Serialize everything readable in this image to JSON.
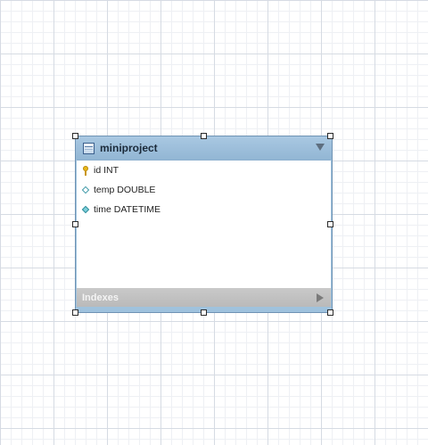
{
  "diagram": {
    "table": {
      "name": "miniproject",
      "columns": [
        {
          "icon": "primary-key-icon",
          "text": "id INT"
        },
        {
          "icon": "column-diamond-icon",
          "text": "temp DOUBLE"
        },
        {
          "icon": "column-diamond-filled-icon",
          "text": "time DATETIME"
        }
      ],
      "indexes_label": "Indexes"
    },
    "colors": {
      "header": "#9fc2dd",
      "indexes_bar": "#c4c4c4",
      "grid": "#d6dbe3"
    }
  }
}
